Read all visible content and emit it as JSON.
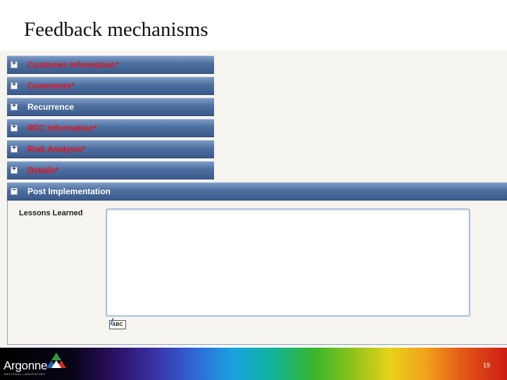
{
  "slide": {
    "title": "Feedback mechanisms",
    "page_number": "19"
  },
  "form": {
    "sections": [
      {
        "label": "Customer Information*",
        "icon": "+",
        "required": true
      },
      {
        "label": "Comments*",
        "icon": "+",
        "required": true
      },
      {
        "label": "Recurrence",
        "icon": "+",
        "required": false
      },
      {
        "label": "RFC Information*",
        "icon": "+",
        "required": true
      },
      {
        "label": "Risk Analysis*",
        "icon": "+",
        "required": true
      },
      {
        "label": "Details*",
        "icon": "+",
        "required": true
      },
      {
        "label": "Post Implementation",
        "icon": "−",
        "required": false
      }
    ],
    "post_implementation": {
      "field_label": "Lessons Learned",
      "value": "",
      "spell_check_label": "ABC"
    }
  },
  "footer": {
    "logo_text": "Argonne",
    "logo_subtext": "NATIONAL LABORATORY"
  },
  "colors": {
    "header_blue": "#4d6f9f",
    "required_label": "#e8121c",
    "form_background": "#f6f4ee"
  }
}
